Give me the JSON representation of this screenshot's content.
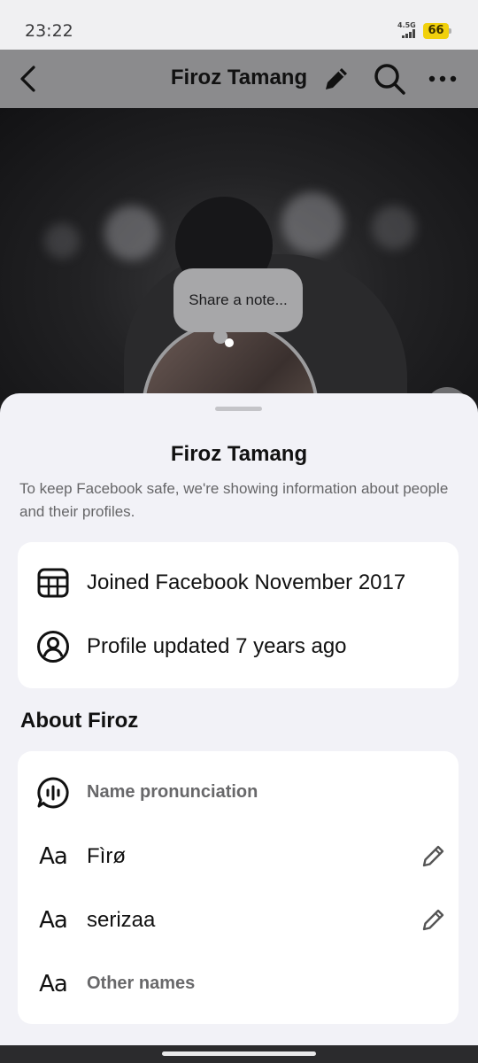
{
  "status": {
    "time": "23:22",
    "network": "4.5G",
    "battery": "66"
  },
  "header": {
    "title": "Firoz Tamang",
    "icons": [
      "back-icon",
      "pencil-icon",
      "search-icon",
      "more-icon"
    ]
  },
  "cover": {
    "note_placeholder": "Share a note..."
  },
  "sheet": {
    "title": "Firoz Tamang",
    "subtitle": "To keep Facebook safe, we're showing information about people and their profiles.",
    "info": {
      "joined": "Joined Facebook November 2017",
      "updated": "Profile updated 7 years ago"
    },
    "about_heading": "About Firoz",
    "about": {
      "pronunciation": "Name pronunciation",
      "name1": "Fìrø",
      "name2": "serizaa",
      "other_names": "Other names",
      "aa_glyph": "Aa"
    }
  },
  "colors": {
    "header_bg": "#8b8b8d",
    "sheet_bg": "#f2f2f7",
    "card_bg": "#ffffff",
    "battery": "#f1d10d"
  }
}
